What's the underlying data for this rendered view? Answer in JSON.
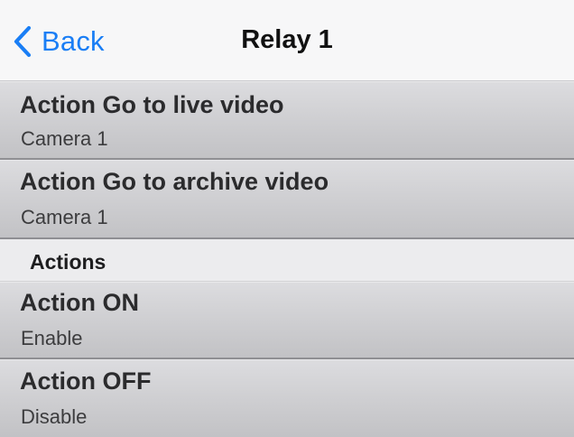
{
  "nav": {
    "back_label": "Back",
    "title": "Relay 1",
    "accent_color": "#1a7ef5"
  },
  "rows_top": [
    {
      "title": "Action Go to live video",
      "subtitle": "Camera 1"
    },
    {
      "title": "Action Go to archive video",
      "subtitle": "Camera 1"
    }
  ],
  "section": {
    "label": "Actions"
  },
  "rows_bottom": [
    {
      "title": "Action ON",
      "subtitle": "Enable"
    },
    {
      "title": "Action OFF",
      "subtitle": "Disable"
    }
  ],
  "icons": {
    "back": "chevron-left-icon"
  }
}
